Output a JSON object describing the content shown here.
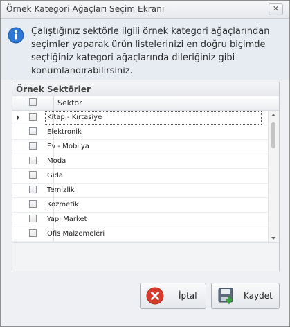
{
  "window": {
    "title": "Örnek Kategori Ağaçları Seçim Ekranı",
    "close_glyph": "✕"
  },
  "info": {
    "icon": "info-icon",
    "text": "Çalıştığınız sektörle ilgili örnek kategori ağaçlarından seçimler yaparak ürün listelerinizi en doğru biçimde seçtiğiniz kategori ağaçlarında dileriğiniz gibi konumlandırabilirsiniz."
  },
  "grid": {
    "group_title": "Örnek Sektörler",
    "column_header": "Sektör",
    "rows": [
      {
        "label": "Kitap - Kırtasiye",
        "selected": true,
        "checked": false
      },
      {
        "label": "Elektronik",
        "selected": false,
        "checked": false
      },
      {
        "label": "Ev - Mobilya",
        "selected": false,
        "checked": false
      },
      {
        "label": "Moda",
        "selected": false,
        "checked": false
      },
      {
        "label": "Gıda",
        "selected": false,
        "checked": false
      },
      {
        "label": "Temizlik",
        "selected": false,
        "checked": false
      },
      {
        "label": "Kozmetik",
        "selected": false,
        "checked": false
      },
      {
        "label": "Yapı Market",
        "selected": false,
        "checked": false
      },
      {
        "label": "Ofis Malzemeleri",
        "selected": false,
        "checked": false
      }
    ]
  },
  "buttons": {
    "cancel_label": "İptal",
    "save_label": "Kaydet"
  },
  "colors": {
    "accent": "#1f6fd1",
    "cancel_red": "#d93a2b",
    "save_green": "#3aa23a"
  }
}
